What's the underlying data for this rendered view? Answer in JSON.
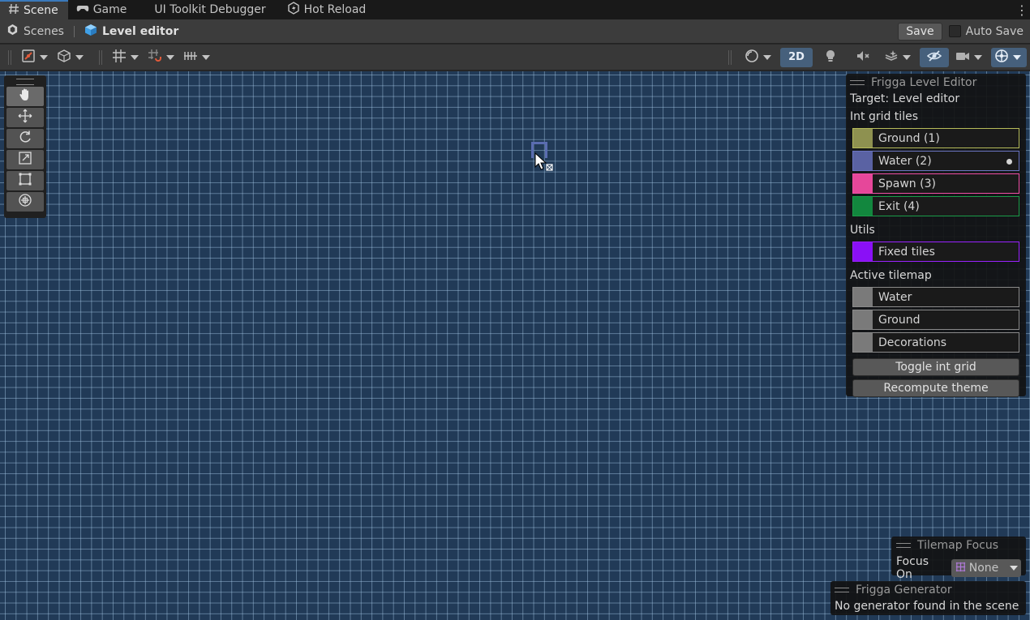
{
  "tabs": [
    {
      "label": "Scene",
      "icon": "hash-icon",
      "active": true
    },
    {
      "label": "Game",
      "icon": "gamepad-icon",
      "active": false
    },
    {
      "label": "UI Toolkit Debugger",
      "icon": "",
      "active": false
    },
    {
      "label": "Hot Reload",
      "icon": "hot-reload-icon",
      "active": false
    }
  ],
  "breadcrumb": {
    "scenes_label": "Scenes",
    "current_label": "Level editor"
  },
  "header_actions": {
    "save_label": "Save",
    "auto_save_label": "Auto Save",
    "auto_save_checked": false
  },
  "toolbar": {
    "mode_2d_label": "2D"
  },
  "level_editor": {
    "title": "Frigga Level Editor",
    "target_text": "Target: Level editor",
    "int_grid_heading": "Int grid tiles",
    "int_grid_tiles": [
      {
        "label": "Ground (1)",
        "color": "#8e9150",
        "border": "#b6bb5a",
        "selected": false
      },
      {
        "label": "Water (2)",
        "color": "#5a62a3",
        "border": "#6a74c0",
        "selected": true
      },
      {
        "label": "Spawn (3)",
        "color": "#e6479a",
        "border": "#f04fa5",
        "selected": false
      },
      {
        "label": "Exit (4)",
        "color": "#12873e",
        "border": "#1a9c48",
        "selected": false
      }
    ],
    "utils_heading": "Utils",
    "utils": [
      {
        "label": "Fixed tiles",
        "color": "#8a10f6",
        "border": "#9a22ff"
      }
    ],
    "active_tilemap_heading": "Active tilemap",
    "active_tilemaps": [
      {
        "label": "Water",
        "color": "#7a7a7a",
        "border": "#8a8a8a"
      },
      {
        "label": "Ground",
        "color": "#7a7a7a",
        "border": "#8a8a8a"
      },
      {
        "label": "Decorations",
        "color": "#7a7a7a",
        "border": "#8a8a8a"
      }
    ],
    "toggle_int_grid_label": "Toggle int grid",
    "recompute_theme_label": "Recompute theme"
  },
  "tilemap_focus": {
    "title": "Tilemap Focus",
    "focus_on_label": "Focus On",
    "focus_value": "None"
  },
  "generator": {
    "title": "Frigga Generator",
    "message": "No generator found in the scene"
  },
  "colors": {
    "scene_bg": "#213a57",
    "accent": "#3a79bb"
  }
}
